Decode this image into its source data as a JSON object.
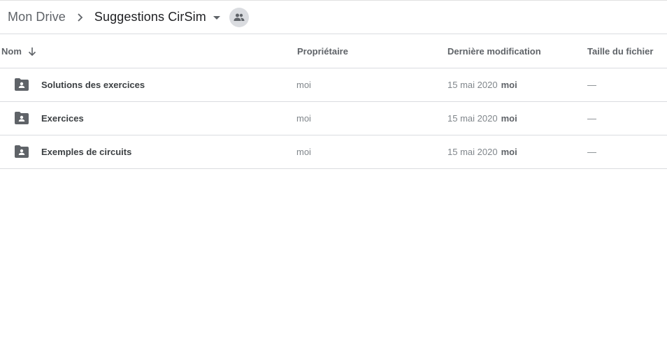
{
  "breadcrumb": {
    "root": "Mon Drive",
    "separator_icon": "chevron-right-icon",
    "current": "Suggestions CirSim",
    "caret_icon": "caret-down-icon",
    "shared_icon": "people-icon"
  },
  "columns": {
    "name": "Nom",
    "sort_icon": "arrow-down-icon",
    "owner": "Propriétaire",
    "modified": "Dernière modification",
    "size": "Taille du fichier"
  },
  "rows": [
    {
      "icon": "shared-folder-icon",
      "name": "Solutions des exercices",
      "owner": "moi",
      "modified_date": "15 mai 2020",
      "modified_by": "moi",
      "size": "—"
    },
    {
      "icon": "shared-folder-icon",
      "name": "Exercices",
      "owner": "moi",
      "modified_date": "15 mai 2020",
      "modified_by": "moi",
      "size": "—"
    },
    {
      "icon": "shared-folder-icon",
      "name": "Exemples de circuits",
      "owner": "moi",
      "modified_date": "15 mai 2020",
      "modified_by": "moi",
      "size": "—"
    }
  ],
  "colors": {
    "folder": "#5f6368",
    "divider": "#dadce0",
    "badge": "#dadce0"
  }
}
